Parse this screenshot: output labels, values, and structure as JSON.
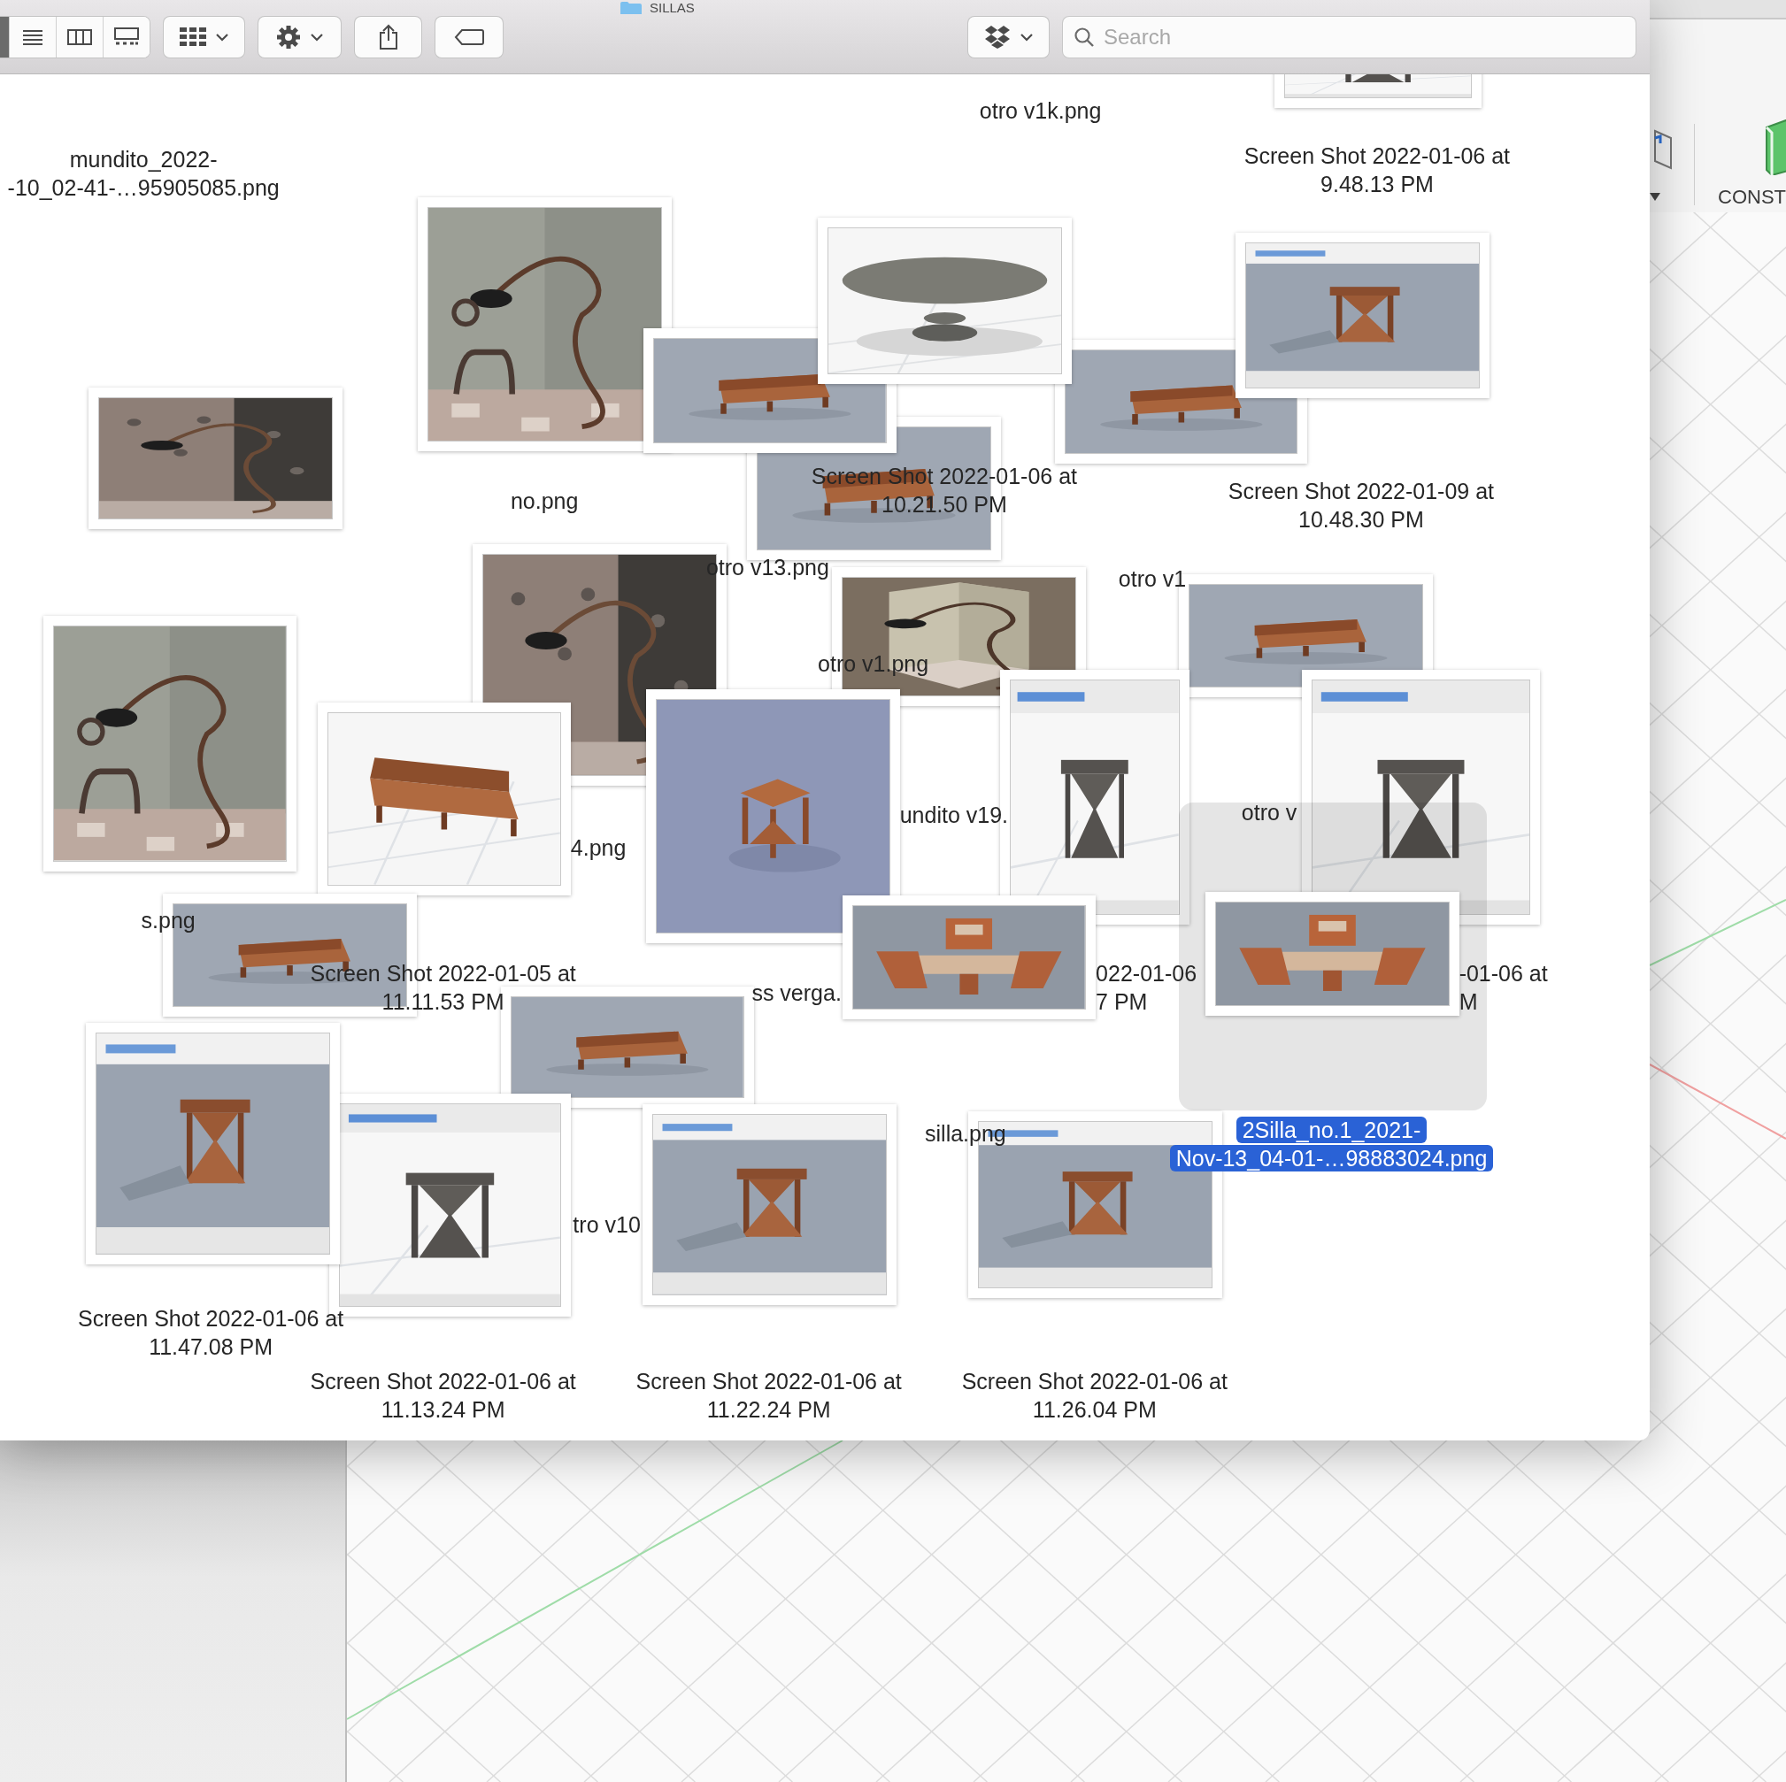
{
  "window": {
    "title": "SILLAS"
  },
  "toolbar": {
    "view_modes": [
      {
        "kind": "icons",
        "selected": true
      },
      {
        "kind": "list",
        "selected": false
      },
      {
        "kind": "columns",
        "selected": false
      },
      {
        "kind": "gallery",
        "selected": false
      }
    ],
    "search": {
      "placeholder": "Search"
    }
  },
  "files": [
    {
      "lines": [
        "otro v1k.png"
      ],
      "selected": false
    },
    {
      "lines": [
        "mundito_2022-",
        "-10_02-41-…95905085.png"
      ],
      "selected": false
    },
    {
      "lines": [
        "Screen Shot 2022-01-06 at",
        "9.48.13 PM"
      ],
      "selected": false
    },
    {
      "lines": [
        "no.png"
      ],
      "selected": false
    },
    {
      "lines": [
        "Screen Shot 2022-01-06 at",
        "10.21.50 PM"
      ],
      "selected": false
    },
    {
      "lines": [
        "Screen Shot 2022-01-09 at",
        "10.48.30 PM"
      ],
      "selected": false
    },
    {
      "lines": [
        "otro v13.png"
      ],
      "selected": false
    },
    {
      "lines": [
        "otro v1"
      ],
      "selected": false
    },
    {
      "lines": [
        "otro v1.png"
      ],
      "selected": false
    },
    {
      "lines": [
        "otro v"
      ],
      "selected": false
    },
    {
      "lines": [
        "undito v19."
      ],
      "selected": false
    },
    {
      "lines": [
        "4.png"
      ],
      "selected": false
    },
    {
      "lines": [
        "s.png"
      ],
      "selected": false
    },
    {
      "lines": [
        "Screen Shot 2022-01-05 at",
        "11.11.53 PM"
      ],
      "selected": false
    },
    {
      "lines": [
        "ss verga."
      ],
      "selected": false
    },
    {
      "lines": [
        "022-01-06",
        "7 PM"
      ],
      "selected": false
    },
    {
      "lines": [
        "-01-06 at",
        "M"
      ],
      "selected": false
    },
    {
      "lines": [
        "silla.png"
      ],
      "selected": false
    },
    {
      "lines": [
        "2Silla_no.1_2021-",
        "Nov-13_04-01-…98883024.png"
      ],
      "selected": true
    },
    {
      "lines": [
        "tro v10"
      ],
      "selected": false
    },
    {
      "lines": [
        "Screen Shot 2022-01-06 at",
        "11.47.08 PM"
      ],
      "selected": false
    },
    {
      "lines": [
        "Screen Shot 2022-01-06 at",
        "11.13.24 PM"
      ],
      "selected": false
    },
    {
      "lines": [
        "Screen Shot 2022-01-06 at",
        "11.22.24 PM"
      ],
      "selected": false
    },
    {
      "lines": [
        "Screen Shot 2022-01-06 at",
        "11.26.04 PM"
      ],
      "selected": false
    }
  ],
  "background_app": {
    "label": "CONST"
  }
}
